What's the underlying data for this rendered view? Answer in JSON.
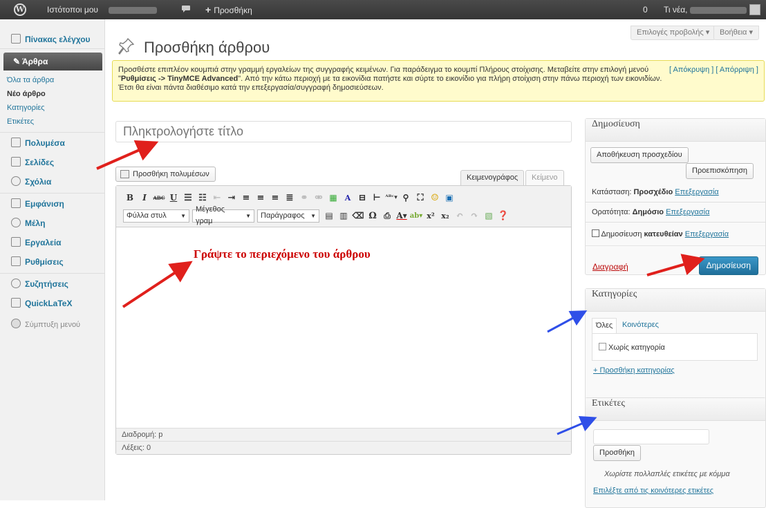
{
  "adminbar": {
    "my_sites": "Ιστότοποι μου",
    "add_new": "Προσθήκη",
    "updates_count": "0",
    "greeting": "Τι νέα,"
  },
  "sidebar": {
    "dashboard": "Πίνακας ελέγχου",
    "posts": "Άρθρα",
    "posts_sub": [
      "Όλα τα άρθρα",
      "Νέο άρθρο",
      "Κατηγορίες",
      "Ετικέτες"
    ],
    "media": "Πολυμέσα",
    "pages": "Σελίδες",
    "comments": "Σχόλια",
    "appearance": "Εμφάνιση",
    "users": "Μέλη",
    "tools": "Εργαλεία",
    "settings": "Ρυθμίσεις",
    "discussions": "Συζητήσεις",
    "quicklatex": "QuickLaTeX",
    "collapse": "Σύμπτυξη μενού"
  },
  "header": {
    "screen_options": "Επιλογές προβολής",
    "help": "Βοήθεια",
    "title": "Προσθήκη άρθρου"
  },
  "notice": {
    "line1": "Προσθέστε επιπλέον κουμπιά στην γραμμή εργαλείων της συγγραφής κειμένων. Για παράδειγμα το κουμπί Πλήρους στοίχισης. Μεταβείτε στην επιλογή μενού",
    "bold_path": "Ρυθμίσεις -> TinyMCE Advanced",
    "line2": ". Από την κάτω περιοχή με τα εικονίδια πατήστε και σύρτε το εικονίδιο για πλήρη στοίχιση στην πάνω περιοχή των εικονιδίων.",
    "line3": "Έτσι θα είναι πάντα διαθέσιμο κατά την επεξεργασία/συγγραφή δημοσιεύσεων.",
    "hide": "[ Απόκρυψη ]",
    "dismiss": "[ Απόρριψη ]"
  },
  "editor": {
    "title_placeholder": "Πληκτρολογήστε τίτλο",
    "add_media": "Προσθήκη πολυμέσων",
    "tab_visual": "Κειμενογράφος",
    "tab_text": "Κείμενο",
    "styles": "Φύλλα στυλ",
    "font_size": "Μέγεθος γραμ",
    "format": "Παράγραφος",
    "hint": "Γράψτε το περιεχόμενο του άρθρου",
    "path": "Διαδρομή: p",
    "word_count": "Λέξεις: 0"
  },
  "publish": {
    "title": "Δημοσίευση",
    "save_draft": "Αποθήκευση προσχεδίου",
    "preview": "Προεπισκόπηση",
    "status_label": "Κατάσταση:",
    "status_value": "Προσχέδιο",
    "visibility_label": "Ορατότητα:",
    "visibility_value": "Δημόσιο",
    "schedule_label": "Δημοσίευση",
    "schedule_value": "κατευθείαν",
    "edit": "Επεξεργασία",
    "delete": "Διαγραφή",
    "publish_button": "Δημοσίευση"
  },
  "categories": {
    "title": "Κατηγορίες",
    "tab_all": "Όλες",
    "tab_popular": "Κοινότερες",
    "uncategorized": "Χωρίς κατηγορία",
    "add_new": "+ Προσθήκη κατηγορίας"
  },
  "tags": {
    "title": "Ετικέτες",
    "add_button": "Προσθήκη",
    "help": "Χωρίστε πολλαπλές ετικέτες με κόμμα",
    "choose": "Επιλέξτε από τις κοινότερες ετικέτες"
  },
  "colors": {
    "admin_bar": "#464646",
    "link": "#21759b",
    "publish_button": "#2a84b8",
    "annotation_red": "#e0201c",
    "annotation_blue": "#2f4fe8",
    "hint_red": "#cc0000"
  }
}
